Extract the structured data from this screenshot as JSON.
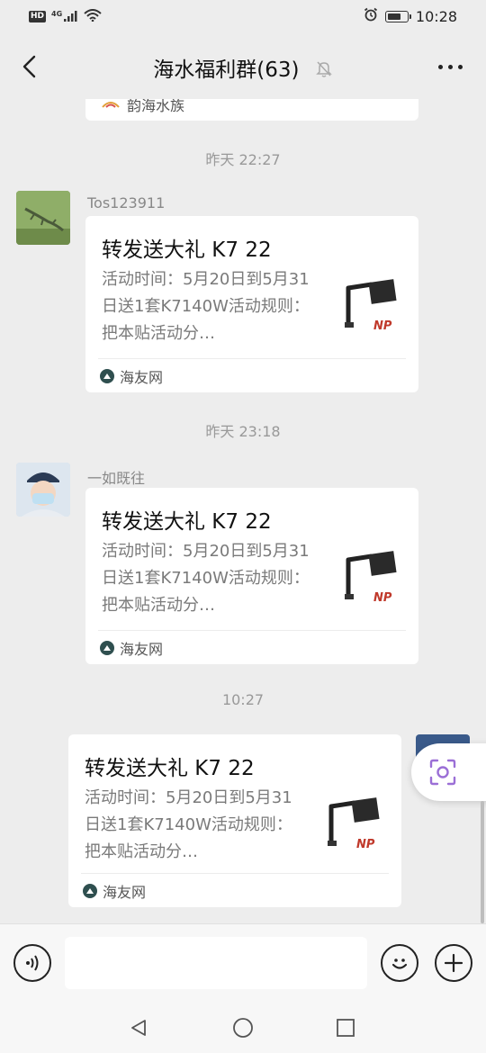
{
  "status_bar": {
    "hd": "HD",
    "network": "4G",
    "time": "10:28",
    "battery_level": 0.75
  },
  "header": {
    "title": "海水福利群(63)"
  },
  "previous_card": {
    "source": "韵海水族"
  },
  "messages": [
    {
      "timestamp": "昨天 22:27",
      "sender": "Tos123911",
      "card": {
        "title": "转发送大礼 K7 22",
        "desc": "活动时间：5月20日到5月31日送1套K7140W活动规则：把本贴活动分…",
        "source": "海友网"
      }
    },
    {
      "timestamp": "昨天 23:18",
      "sender": "一如既往",
      "card": {
        "title": "转发送大礼 K7 22",
        "desc": "活动时间：5月20日到5月31日送1套K7140W活动规则：把本贴活动分…",
        "source": "海友网"
      }
    },
    {
      "timestamp": "10:27",
      "sender": "",
      "card": {
        "title": "转发送大礼 K7 22",
        "desc": "活动时间：5月20日到5月31日送1套K7140W活动规则：把本贴活动分…",
        "source": "海友网"
      }
    }
  ],
  "thumb_brand": "NP",
  "input": {
    "value": "",
    "placeholder": ""
  },
  "colors": {
    "background": "#ededed",
    "card": "#ffffff",
    "scan_accent": "#9b6fd6"
  },
  "icons": {
    "back": "chevron-left-icon",
    "mute": "bell-off-icon",
    "more": "more-icon",
    "voice": "voice-icon",
    "emoji": "emoji-icon",
    "plus": "plus-icon",
    "scan": "scan-icon"
  }
}
